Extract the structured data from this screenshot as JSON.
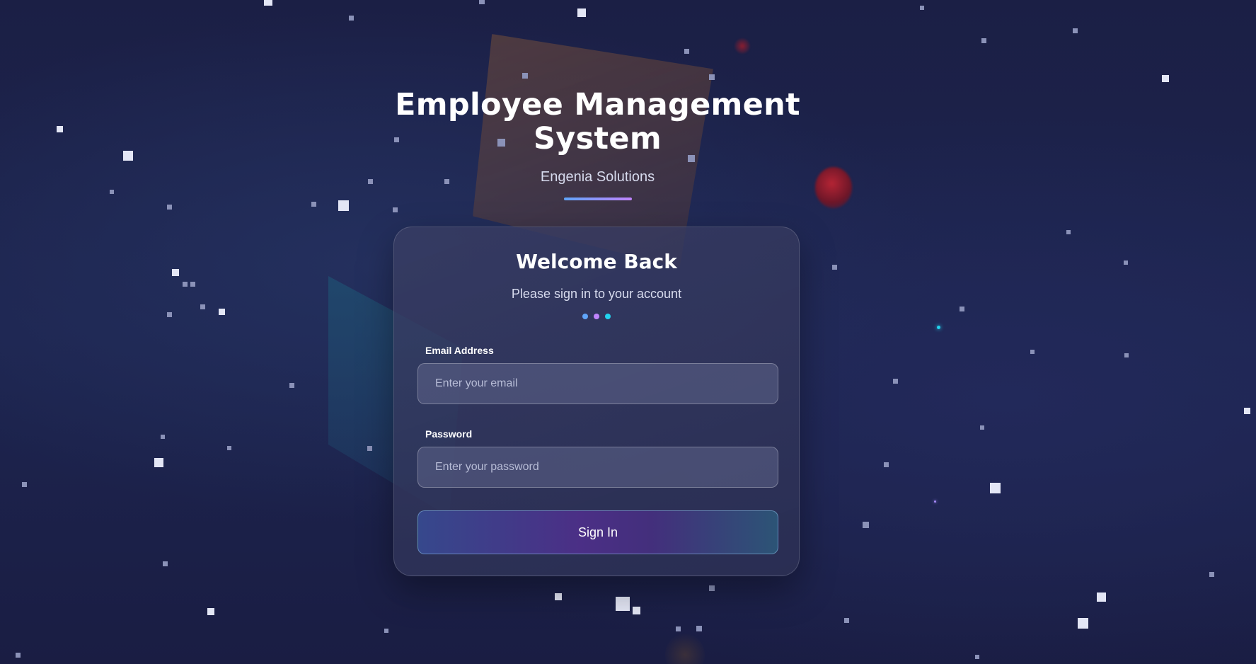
{
  "header": {
    "title_line1": "Employee Management",
    "title_line2": "System",
    "subtitle": "Engenia Solutions"
  },
  "login_card": {
    "title": "Welcome Back",
    "subtitle": "Please sign in to your account",
    "email": {
      "label": "Email Address",
      "placeholder": "Enter your email",
      "value": ""
    },
    "password": {
      "label": "Password",
      "placeholder": "Enter your password",
      "value": ""
    },
    "submit_label": "Sign In"
  },
  "colors": {
    "accent_blue": "#60a5fa",
    "accent_purple": "#c084fc",
    "accent_cyan": "#22d3ee",
    "background": "#1b1f45"
  }
}
